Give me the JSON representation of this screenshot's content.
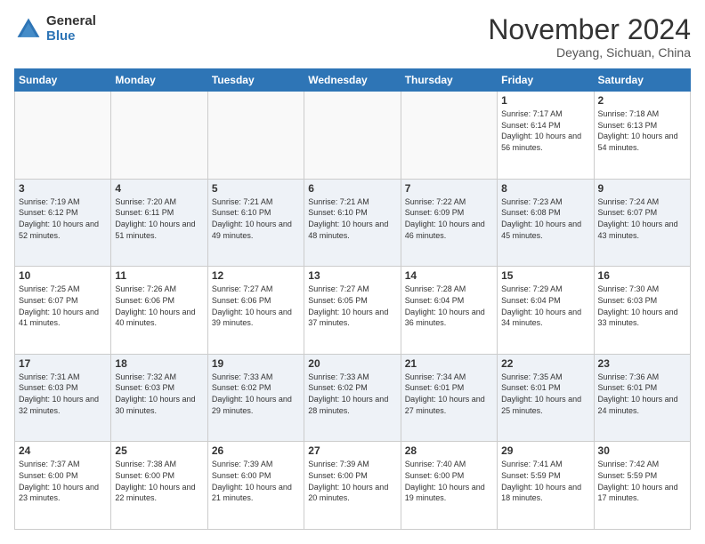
{
  "header": {
    "logo_general": "General",
    "logo_blue": "Blue",
    "month_title": "November 2024",
    "location": "Deyang, Sichuan, China"
  },
  "calendar": {
    "days_of_week": [
      "Sunday",
      "Monday",
      "Tuesday",
      "Wednesday",
      "Thursday",
      "Friday",
      "Saturday"
    ],
    "rows": [
      [
        {
          "day": "",
          "info": ""
        },
        {
          "day": "",
          "info": ""
        },
        {
          "day": "",
          "info": ""
        },
        {
          "day": "",
          "info": ""
        },
        {
          "day": "",
          "info": ""
        },
        {
          "day": "1",
          "info": "Sunrise: 7:17 AM\nSunset: 6:14 PM\nDaylight: 10 hours and 56 minutes."
        },
        {
          "day": "2",
          "info": "Sunrise: 7:18 AM\nSunset: 6:13 PM\nDaylight: 10 hours and 54 minutes."
        }
      ],
      [
        {
          "day": "3",
          "info": "Sunrise: 7:19 AM\nSunset: 6:12 PM\nDaylight: 10 hours and 52 minutes."
        },
        {
          "day": "4",
          "info": "Sunrise: 7:20 AM\nSunset: 6:11 PM\nDaylight: 10 hours and 51 minutes."
        },
        {
          "day": "5",
          "info": "Sunrise: 7:21 AM\nSunset: 6:10 PM\nDaylight: 10 hours and 49 minutes."
        },
        {
          "day": "6",
          "info": "Sunrise: 7:21 AM\nSunset: 6:10 PM\nDaylight: 10 hours and 48 minutes."
        },
        {
          "day": "7",
          "info": "Sunrise: 7:22 AM\nSunset: 6:09 PM\nDaylight: 10 hours and 46 minutes."
        },
        {
          "day": "8",
          "info": "Sunrise: 7:23 AM\nSunset: 6:08 PM\nDaylight: 10 hours and 45 minutes."
        },
        {
          "day": "9",
          "info": "Sunrise: 7:24 AM\nSunset: 6:07 PM\nDaylight: 10 hours and 43 minutes."
        }
      ],
      [
        {
          "day": "10",
          "info": "Sunrise: 7:25 AM\nSunset: 6:07 PM\nDaylight: 10 hours and 41 minutes."
        },
        {
          "day": "11",
          "info": "Sunrise: 7:26 AM\nSunset: 6:06 PM\nDaylight: 10 hours and 40 minutes."
        },
        {
          "day": "12",
          "info": "Sunrise: 7:27 AM\nSunset: 6:06 PM\nDaylight: 10 hours and 39 minutes."
        },
        {
          "day": "13",
          "info": "Sunrise: 7:27 AM\nSunset: 6:05 PM\nDaylight: 10 hours and 37 minutes."
        },
        {
          "day": "14",
          "info": "Sunrise: 7:28 AM\nSunset: 6:04 PM\nDaylight: 10 hours and 36 minutes."
        },
        {
          "day": "15",
          "info": "Sunrise: 7:29 AM\nSunset: 6:04 PM\nDaylight: 10 hours and 34 minutes."
        },
        {
          "day": "16",
          "info": "Sunrise: 7:30 AM\nSunset: 6:03 PM\nDaylight: 10 hours and 33 minutes."
        }
      ],
      [
        {
          "day": "17",
          "info": "Sunrise: 7:31 AM\nSunset: 6:03 PM\nDaylight: 10 hours and 32 minutes."
        },
        {
          "day": "18",
          "info": "Sunrise: 7:32 AM\nSunset: 6:03 PM\nDaylight: 10 hours and 30 minutes."
        },
        {
          "day": "19",
          "info": "Sunrise: 7:33 AM\nSunset: 6:02 PM\nDaylight: 10 hours and 29 minutes."
        },
        {
          "day": "20",
          "info": "Sunrise: 7:33 AM\nSunset: 6:02 PM\nDaylight: 10 hours and 28 minutes."
        },
        {
          "day": "21",
          "info": "Sunrise: 7:34 AM\nSunset: 6:01 PM\nDaylight: 10 hours and 27 minutes."
        },
        {
          "day": "22",
          "info": "Sunrise: 7:35 AM\nSunset: 6:01 PM\nDaylight: 10 hours and 25 minutes."
        },
        {
          "day": "23",
          "info": "Sunrise: 7:36 AM\nSunset: 6:01 PM\nDaylight: 10 hours and 24 minutes."
        }
      ],
      [
        {
          "day": "24",
          "info": "Sunrise: 7:37 AM\nSunset: 6:00 PM\nDaylight: 10 hours and 23 minutes."
        },
        {
          "day": "25",
          "info": "Sunrise: 7:38 AM\nSunset: 6:00 PM\nDaylight: 10 hours and 22 minutes."
        },
        {
          "day": "26",
          "info": "Sunrise: 7:39 AM\nSunset: 6:00 PM\nDaylight: 10 hours and 21 minutes."
        },
        {
          "day": "27",
          "info": "Sunrise: 7:39 AM\nSunset: 6:00 PM\nDaylight: 10 hours and 20 minutes."
        },
        {
          "day": "28",
          "info": "Sunrise: 7:40 AM\nSunset: 6:00 PM\nDaylight: 10 hours and 19 minutes."
        },
        {
          "day": "29",
          "info": "Sunrise: 7:41 AM\nSunset: 5:59 PM\nDaylight: 10 hours and 18 minutes."
        },
        {
          "day": "30",
          "info": "Sunrise: 7:42 AM\nSunset: 5:59 PM\nDaylight: 10 hours and 17 minutes."
        }
      ]
    ]
  }
}
